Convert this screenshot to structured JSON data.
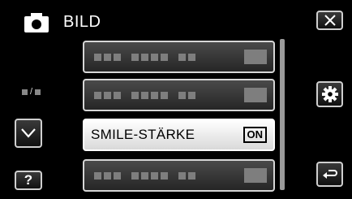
{
  "header": {
    "title": "BILD",
    "icon": "camera-icon"
  },
  "menu": {
    "items": [
      {
        "type": "placeholder"
      },
      {
        "type": "placeholder"
      },
      {
        "type": "selected",
        "label": "SMILE-STÄRKE",
        "value": "ON"
      },
      {
        "type": "placeholder"
      }
    ]
  },
  "controls": {
    "close_icon": "close-icon",
    "settings_icon": "gear-icon",
    "back_icon": "return-icon",
    "down_icon": "chevron-down-icon",
    "help_label": "?"
  },
  "colors": {
    "background": "#000000",
    "highlight": "#ffffff",
    "placeholder": "#7e7e7e"
  }
}
